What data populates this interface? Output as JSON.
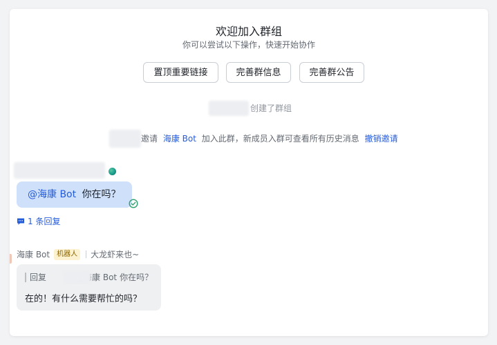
{
  "welcome": {
    "title": "欢迎加入群组",
    "subtitle": "你可以尝试以下操作，快速开始协作"
  },
  "actions": {
    "pin_link": "置顶重要链接",
    "complete_info": "完善群信息",
    "complete_notice": "完善群公告"
  },
  "system": {
    "created_group": "创建了群组",
    "invite_prefix": "邀请",
    "invited_bot": "海康 Bot",
    "invite_suffix": "加入此群，新成员入群可查看所有历史消息",
    "revoke_invite": "撤销邀请"
  },
  "message_me": {
    "mention": "@海康 Bot",
    "text": "你在吗？",
    "status_icon": "check-circle-icon",
    "reply_count": "1 条回复",
    "reply_icon": "reply-thread-icon"
  },
  "message_bot": {
    "sender": "海康 Bot",
    "badge": "机器人",
    "signature": "大龙虾来也~",
    "quote_label": "回复",
    "quote_mention": "@海康 Bot",
    "quote_text": "你在吗？",
    "text": "在的！有什么需要帮忙的吗？"
  },
  "colors": {
    "link": "#245bdb",
    "my_bubble": "#cfe0fb",
    "bot_bubble": "#eff0f1",
    "badge_bg": "#fdf2cf"
  }
}
